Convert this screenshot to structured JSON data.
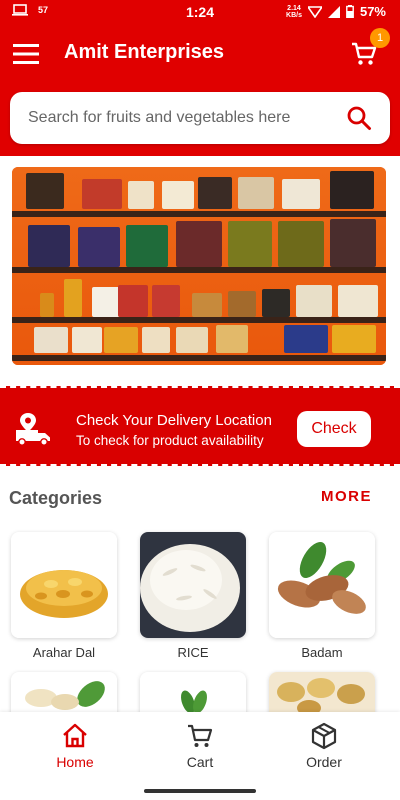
{
  "status_bar": {
    "notification_count": "57",
    "time": "1:24",
    "net_speed_value": "2.14",
    "net_speed_unit": "KB/s",
    "battery": "57%"
  },
  "app_bar": {
    "title": "Amit Enterprises",
    "cart_count": "1",
    "icons": {
      "menu": "hamburger-icon",
      "cart": "cart-icon",
      "search": "search-icon"
    }
  },
  "search": {
    "placeholder": "Search for fruits and vegetables here"
  },
  "delivery": {
    "title": "Check Your Delivery Location",
    "subtitle": "To check for product availability",
    "button": "Check"
  },
  "categories": {
    "heading": "Categories",
    "more": "MORE",
    "items": [
      {
        "label": "Arahar Dal"
      },
      {
        "label": "RICE"
      },
      {
        "label": "Badam"
      }
    ]
  },
  "bottom_nav": {
    "items": [
      {
        "label": "Home",
        "icon": "home-icon",
        "active": true
      },
      {
        "label": "Cart",
        "icon": "cart-icon",
        "active": false
      },
      {
        "label": "Order",
        "icon": "box-icon",
        "active": false
      }
    ]
  },
  "colors": {
    "primary": "#e00000",
    "accent": "#d90000",
    "badge": "#ff9800"
  }
}
